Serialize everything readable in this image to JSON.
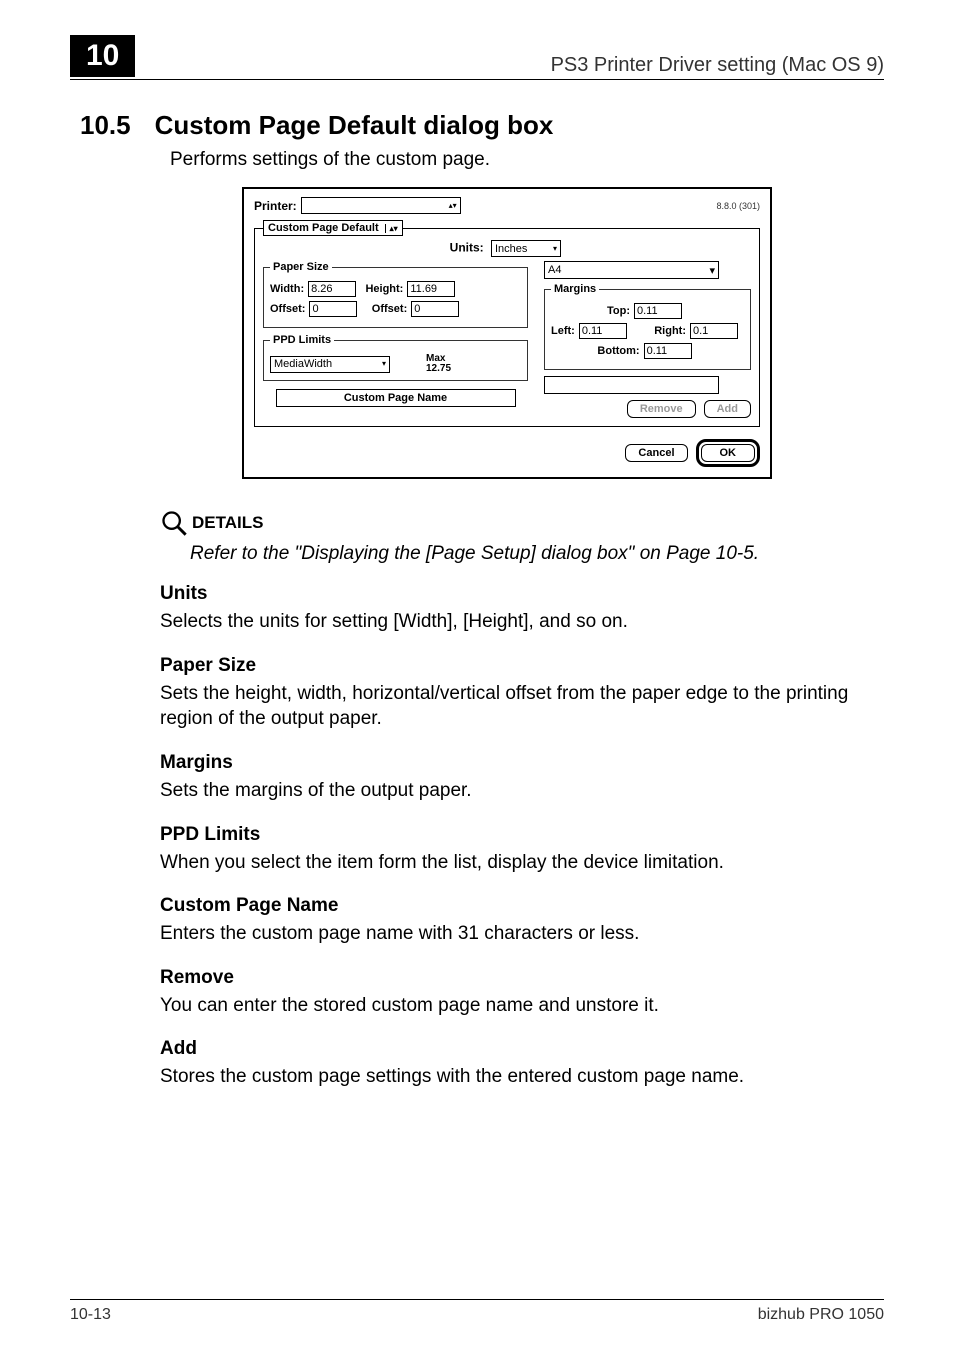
{
  "header": {
    "chapter": "10",
    "title": "PS3 Printer Driver setting (Mac OS 9)"
  },
  "section": {
    "number": "10.5",
    "title": "Custom Page Default dialog box",
    "intro": "Performs settings of the custom page."
  },
  "dialog": {
    "printer_label": "Printer:",
    "version": "8.8.0 (301)",
    "cpd_legend": "Custom Page Default",
    "units_label": "Units:",
    "units_value": "Inches",
    "paper_size_legend": "Paper Size",
    "width_lbl": "Width:",
    "width_val": "8.26",
    "height_lbl": "Height:",
    "height_val": "11.69",
    "off1_lbl": "Offset:",
    "off1_val": "0",
    "off2_lbl": "Offset:",
    "off2_val": "0",
    "ppd_legend": "PPD Limits",
    "ppd_item": "MediaWidth",
    "ppd_max_lbl": "Max",
    "ppd_max_val": "12.75",
    "cpn_label": "Custom Page Name",
    "name_select": "A4",
    "margins_legend": "Margins",
    "top_lbl": "Top:",
    "top_val": "0.11",
    "left_lbl": "Left:",
    "left_val": "0.11",
    "right_lbl": "Right:",
    "right_val": "0.1",
    "bottom_lbl": "Bottom:",
    "bottom_val": "0.11",
    "remove": "Remove",
    "add": "Add",
    "cancel": "Cancel",
    "ok": "OK"
  },
  "details_label": "DETAILS",
  "details_ref": "Refer to the \"Displaying the [Page Setup] dialog box\" on Page 10-5.",
  "sections": {
    "units_h": "Units",
    "units_p": "Selects the units for setting [Width], [Height], and so on.",
    "paper_h": "Paper Size",
    "paper_p": "Sets the height, width, horizontal/vertical offset from the paper edge to the printing region of the output paper.",
    "margins_h": "Margins",
    "margins_p": "Sets the margins of the output paper.",
    "ppd_h": "PPD Limits",
    "ppd_p": "When you select the item form the list, display the device limitation.",
    "cpn_h": "Custom Page Name",
    "cpn_p": "Enters the custom page name with 31 characters or less.",
    "remove_h": "Remove",
    "remove_p": "You can enter the stored custom page name and unstore it.",
    "add_h": "Add",
    "add_p": "Stores the custom page settings with the entered custom page name."
  },
  "footer": {
    "left": "10-13",
    "right": "bizhub PRO 1050"
  }
}
